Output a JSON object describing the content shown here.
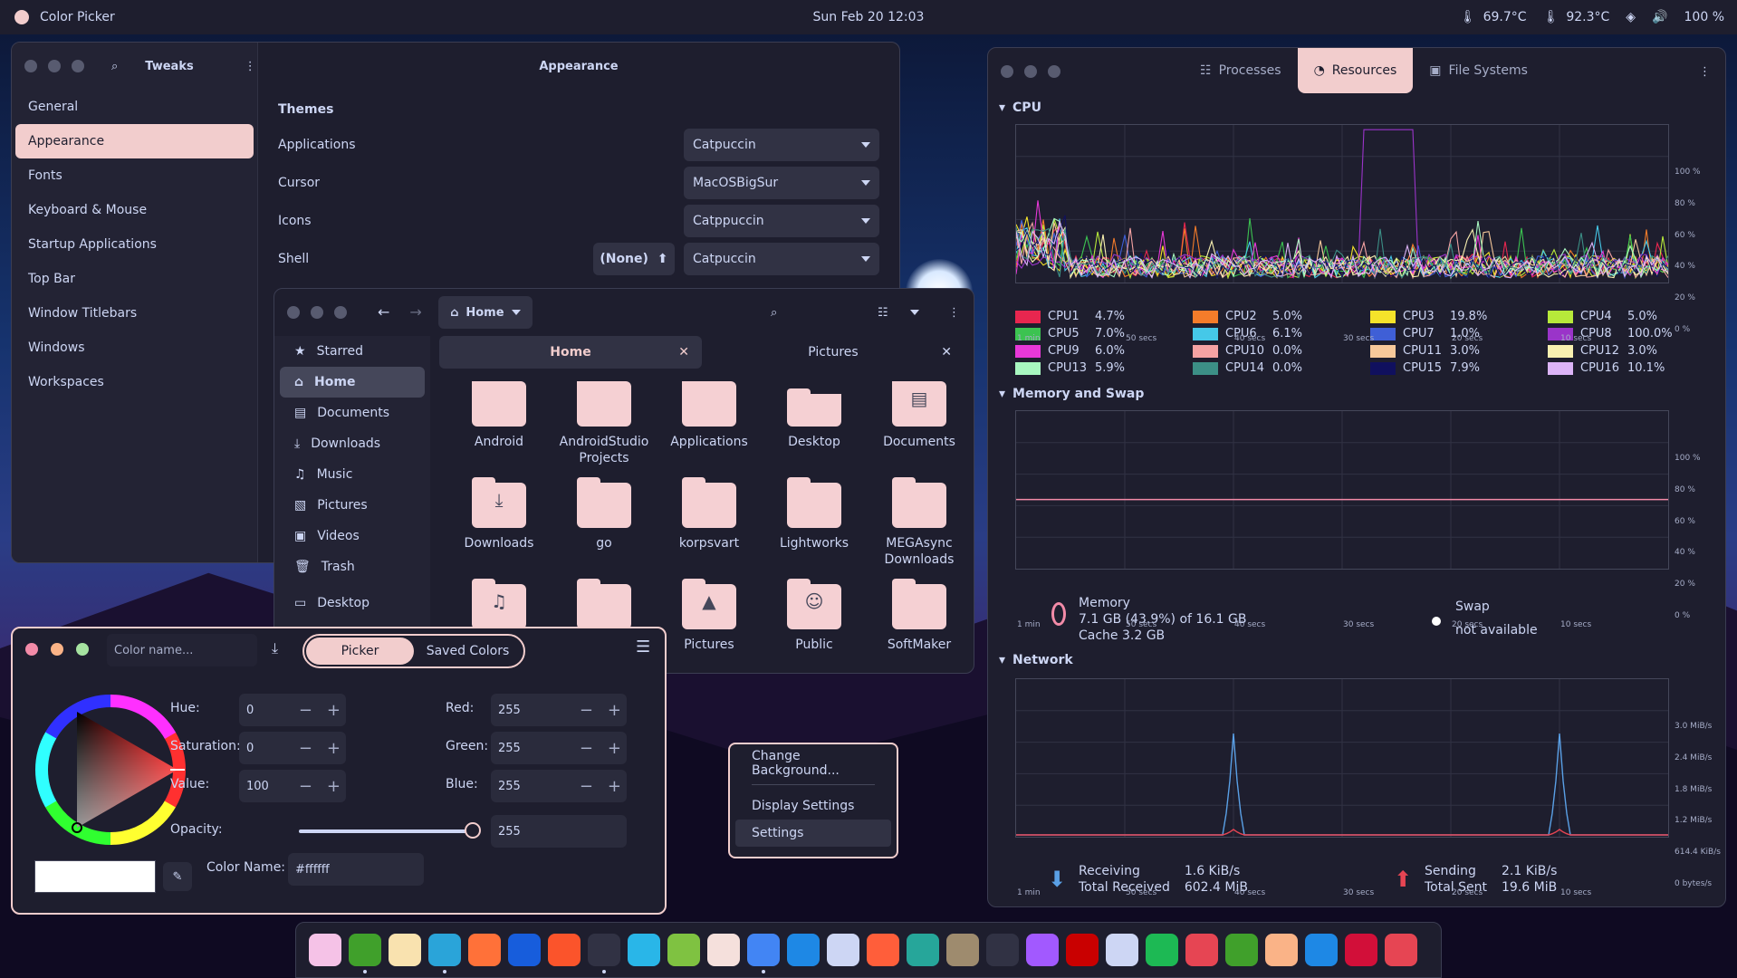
{
  "topbar": {
    "app_name": "Color Picker",
    "clock": "Sun Feb 20  12:03",
    "temp1": "69.7°C",
    "temp2": "92.3°C",
    "battery": "100 %"
  },
  "tweaks": {
    "title": "Tweaks",
    "page_title": "Appearance",
    "section": "Themes",
    "nav": [
      "General",
      "Appearance",
      "Fonts",
      "Keyboard & Mouse",
      "Startup Applications",
      "Top Bar",
      "Window Titlebars",
      "Windows",
      "Workspaces"
    ],
    "rows": [
      {
        "label": "Applications",
        "value": "Catpuccin"
      },
      {
        "label": "Cursor",
        "value": "MacOSBigSur"
      },
      {
        "label": "Icons",
        "value": "Catppuccin"
      },
      {
        "label": "Shell",
        "value": "Catpuccin",
        "extra": "(None)"
      }
    ]
  },
  "files": {
    "location": "Home",
    "sidebar": [
      "Starred",
      "Home",
      "Documents",
      "Downloads",
      "Music",
      "Pictures",
      "Videos",
      "Trash",
      "Desktop"
    ],
    "tabs": [
      "Home",
      "Pictures"
    ],
    "items": [
      "Android",
      "AndroidStudio Projects",
      "Applications",
      "Desktop",
      "Documents",
      "Downloads",
      "go",
      "korpsvart",
      "Lightworks",
      "MEGAsync Downloads",
      "",
      "",
      "Pictures",
      "Public",
      "SoftMaker"
    ]
  },
  "picker": {
    "name_placeholder": "Color name...",
    "tab_picker": "Picker",
    "tab_saved": "Saved Colors",
    "hue_label": "Hue:",
    "hue": "0",
    "sat_label": "Saturation:",
    "sat": "0",
    "val_label": "Value:",
    "val": "100",
    "red_label": "Red:",
    "red": "255",
    "green_label": "Green:",
    "green": "255",
    "blue_label": "Blue:",
    "blue": "255",
    "opacity_label": "Opacity:",
    "opacity": "255",
    "opacity_fraction": 1.0,
    "colorname_label": "Color Name:",
    "colorname": "#ffffff"
  },
  "context_menu": [
    "Change Background...",
    "Display Settings",
    "Settings"
  ],
  "resources": {
    "tabs": [
      "Processes",
      "Resources",
      "File Systems"
    ],
    "cpu_title": "CPU",
    "mem_title": "Memory and Swap",
    "net_title": "Network",
    "xticks": [
      "1 min",
      "50 secs",
      "40 secs",
      "30 secs",
      "20 secs",
      "10 secs"
    ],
    "yticks_pct": [
      "100 %",
      "80 %",
      "60 %",
      "40 %",
      "20 %",
      "0 %"
    ],
    "yticks_net": [
      "3.0 MiB/s",
      "2.4 MiB/s",
      "1.8 MiB/s",
      "1.2 MiB/s",
      "614.4 KiB/s",
      "0 bytes/s"
    ],
    "cpus": [
      {
        "name": "CPU1",
        "val": "4.7%",
        "color": "#e8264f"
      },
      {
        "name": "CPU2",
        "val": "5.0%",
        "color": "#f47c2a"
      },
      {
        "name": "CPU3",
        "val": "19.8%",
        "color": "#f5e32a"
      },
      {
        "name": "CPU4",
        "val": "5.0%",
        "color": "#b7e93a"
      },
      {
        "name": "CPU5",
        "val": "7.0%",
        "color": "#3cc351"
      },
      {
        "name": "CPU6",
        "val": "6.1%",
        "color": "#45c8e8"
      },
      {
        "name": "CPU7",
        "val": "1.0%",
        "color": "#3f5fd6"
      },
      {
        "name": "CPU8",
        "val": "100.0%",
        "color": "#9a34c9"
      },
      {
        "name": "CPU9",
        "val": "6.0%",
        "color": "#e838d8"
      },
      {
        "name": "CPU10",
        "val": "0.0%",
        "color": "#f5a3a3"
      },
      {
        "name": "CPU11",
        "val": "3.0%",
        "color": "#f7c99a"
      },
      {
        "name": "CPU12",
        "val": "3.0%",
        "color": "#f8f0b0"
      },
      {
        "name": "CPU13",
        "val": "5.9%",
        "color": "#a8f7c0"
      },
      {
        "name": "CPU14",
        "val": "0.0%",
        "color": "#3c8f86"
      },
      {
        "name": "CPU15",
        "val": "7.9%",
        "color": "#10105e"
      },
      {
        "name": "CPU16",
        "val": "10.1%",
        "color": "#dcb4f7"
      }
    ],
    "memory_label": "Memory",
    "memory_text": "7.1 GB (43.9%) of 16.1 GB",
    "cache_text": "Cache 3.2 GB",
    "memory_fraction": 0.439,
    "swap_label": "Swap",
    "swap_text": "not available",
    "recv_label": "Receiving",
    "recv": "1.6 KiB/s",
    "total_recv_label": "Total Received",
    "total_recv": "602.4 MiB",
    "send_label": "Sending",
    "send": "2.1 KiB/s",
    "total_sent_label": "Total Sent",
    "total_sent": "19.6 MiB"
  },
  "dock_icons": [
    "alacritty-icon",
    "maps-icon",
    "notes-icon",
    "telegram-icon",
    "firefox-icon",
    "bitwarden-icon",
    "brave-icon",
    "terminal-icon",
    "code-icon",
    "inkscape-icon",
    "text-editor-icon",
    "chrome-icon",
    "mail-icon",
    "calendar-icon",
    "color-icon",
    "screenshot-icon",
    "gimp-icon",
    "pidgin-icon",
    "figma-icon",
    "rider-icon",
    "qemu-icon",
    "spotify-icon",
    "audio-icon",
    "extensions-icon",
    "tweaks-icon",
    "settings-icon",
    "github-icon",
    "trash-icon"
  ],
  "colors": {
    "accent": "#f2cdcd",
    "base": "#1e1e2e"
  }
}
